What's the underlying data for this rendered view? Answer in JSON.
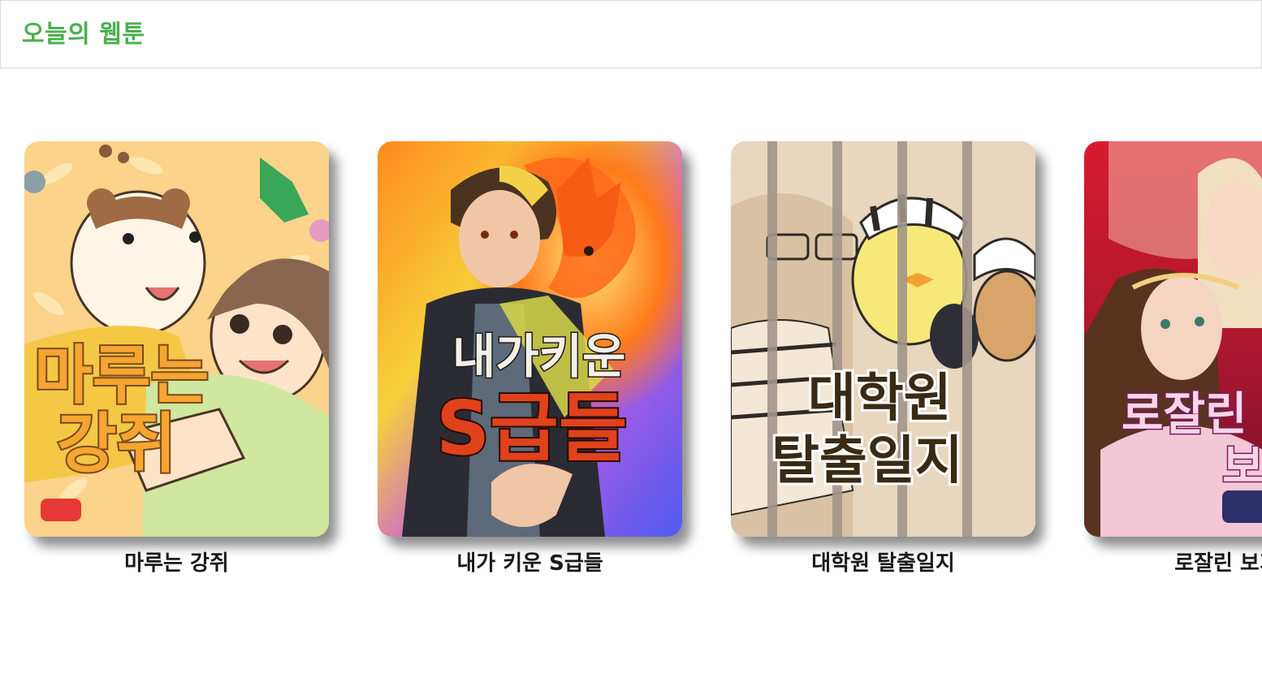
{
  "header": {
    "title": "오늘의 웹툰",
    "title_color": "#4caf50"
  },
  "webtoons": [
    {
      "title": "마루는 강쥐",
      "cover_text_line1": "마루는",
      "cover_text_line2": "강쥐"
    },
    {
      "title": "내가 키운 S급들",
      "cover_text_line1": "내가키운",
      "cover_text_line2": "S급들"
    },
    {
      "title": "대학원 탈출일지",
      "cover_text_line1": "대학원",
      "cover_text_line2": "탈출일지"
    },
    {
      "title": "로잘린 보가트",
      "cover_text_line1": "로잘린",
      "cover_text_line2": "보"
    }
  ]
}
